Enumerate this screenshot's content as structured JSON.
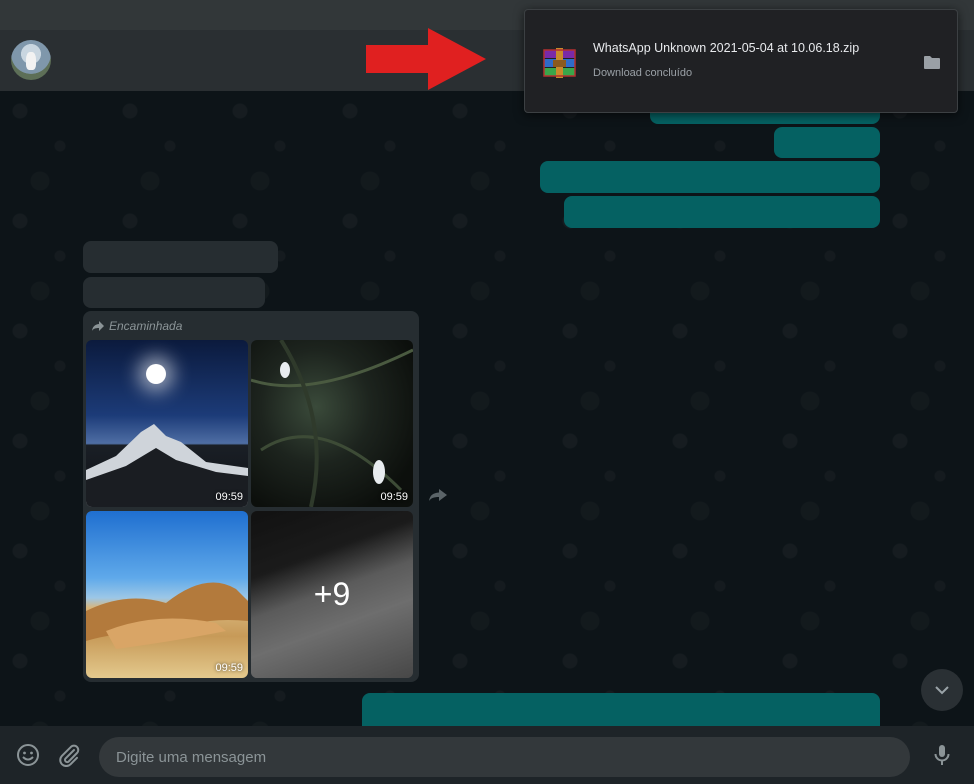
{
  "header": {
    "avatar_icon": "contact-avatar-icon"
  },
  "album": {
    "forwarded_label": "Encaminhada",
    "tiles": [
      {
        "time": "09:59"
      },
      {
        "time": "09:59"
      },
      {
        "time": "09:59"
      },
      {
        "more_count": "+9"
      }
    ]
  },
  "footer": {
    "placeholder": "Digite uma mensagem",
    "emoji_icon": "emoji-icon",
    "attach_icon": "paperclip-icon",
    "mic_icon": "microphone-icon"
  },
  "download": {
    "filename": "WhatsApp Unknown 2021-05-04 at 10.06.18.zip",
    "status": "Download concluído",
    "file_icon": "winrar-archive-icon",
    "folder_icon": "folder-icon"
  },
  "colors": {
    "chat_bg": "#0d1418",
    "outgoing_bubble": "#056162",
    "incoming_bubble": "#262d31",
    "annotation_arrow": "#e02020"
  }
}
